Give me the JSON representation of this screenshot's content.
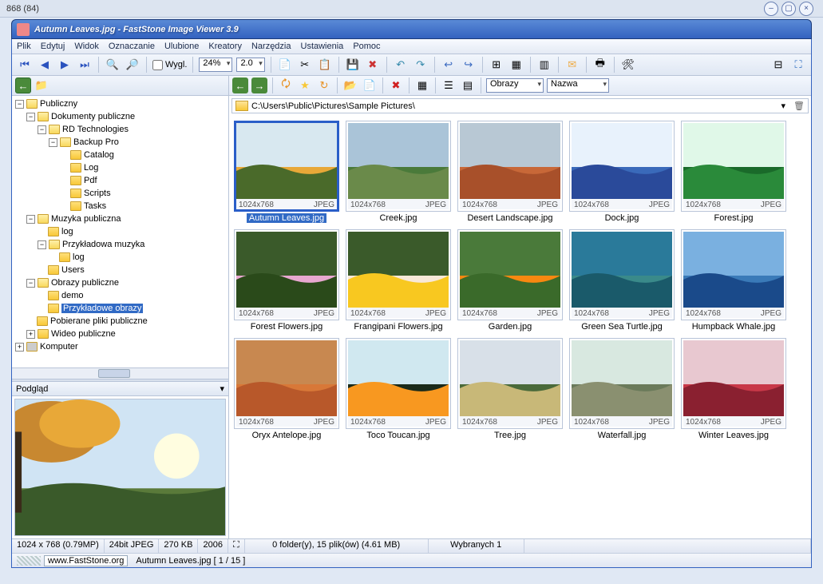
{
  "topbar_text": "868 (84)",
  "window_title": "Autumn Leaves.jpg  -  FastStone Image Viewer 3.9",
  "menu": [
    "Plik",
    "Edytuj",
    "Widok",
    "Oznaczanie",
    "Ulubione",
    "Kreatory",
    "Narzędzia",
    "Ustawienia",
    "Pomoc"
  ],
  "toolbar": {
    "wygl_label": "Wygl.",
    "zoom": "24%",
    "scale": "2.0"
  },
  "tree": {
    "root": "Publiczny",
    "n1": "Dokumenty publiczne",
    "n2": "RD Technologies",
    "n3": "Backup Pro",
    "n3_children": [
      "Catalog",
      "Log",
      "Pdf",
      "Scripts",
      "Tasks"
    ],
    "n4": "Muzyka publiczna",
    "n4a": "log",
    "n4b": "Przykładowa muzyka",
    "n4b1": "log",
    "n4c": "Users",
    "n5": "Obrazy publiczne",
    "n5a": "demo",
    "n5b": "Przykładowe obrazy",
    "n6": "Pobierane pliki publiczne",
    "n7": "Wideo publiczne",
    "n8": "Komputer"
  },
  "preview_label": "Podgląd",
  "right_toolbar": {
    "filter": "Obrazy",
    "sort": "Nazwa"
  },
  "path": "C:\\Users\\Public\\Pictures\\Sample Pictures\\",
  "thumb_dims": "1024x768",
  "thumb_fmt": "JPEG",
  "thumbnails": [
    {
      "name": "Autumn Leaves.jpg",
      "selected": true,
      "c1": "#e8a838",
      "c2": "#4a6a2a",
      "sky": "#d8e8f0"
    },
    {
      "name": "Creek.jpg",
      "c1": "#4a7a3a",
      "c2": "#6a8a4a",
      "sky": "#aac4d8"
    },
    {
      "name": "Desert Landscape.jpg",
      "c1": "#c86838",
      "c2": "#a8502a",
      "sky": "#b8c8d4"
    },
    {
      "name": "Dock.jpg",
      "c1": "#3a6aba",
      "c2": "#2a4a9a",
      "sky": "#e8f2fc"
    },
    {
      "name": "Forest.jpg",
      "c1": "#1a6a2a",
      "c2": "#2a8a3a",
      "sky": "#e0f8e8"
    },
    {
      "name": "Forest Flowers.jpg",
      "c1": "#e8a8d0",
      "c2": "#2a4a1a",
      "sky": "#3a5a2a"
    },
    {
      "name": "Frangipani Flowers.jpg",
      "c1": "#f8e8d8",
      "c2": "#f8c820",
      "sky": "#3a5a2a"
    },
    {
      "name": "Garden.jpg",
      "c1": "#f88810",
      "c2": "#3a6a2a",
      "sky": "#4a7a3a"
    },
    {
      "name": "Green Sea Turtle.jpg",
      "c1": "#3a8a8a",
      "c2": "#1a5a6a",
      "sky": "#2a7a9a"
    },
    {
      "name": "Humpback Whale.jpg",
      "c1": "#3a7ab8",
      "c2": "#1a4a8a",
      "sky": "#7ab0e0"
    },
    {
      "name": "Oryx Antelope.jpg",
      "c1": "#d87838",
      "c2": "#b8582a",
      "sky": "#c88850"
    },
    {
      "name": "Toco Toucan.jpg",
      "c1": "#1a2a1a",
      "c2": "#f89820",
      "sky": "#d0e8f0"
    },
    {
      "name": "Tree.jpg",
      "c1": "#4a6a3a",
      "c2": "#c8b878",
      "sky": "#d8e0e8"
    },
    {
      "name": "Waterfall.jpg",
      "c1": "#6a7a5a",
      "c2": "#8a9070",
      "sky": "#d8e8e0"
    },
    {
      "name": "Winter Leaves.jpg",
      "c1": "#c83848",
      "c2": "#8a2030",
      "sky": "#e8c8d0"
    }
  ],
  "status": {
    "dims": "1024 x 768 (0.79MP)",
    "depth": "24bit JPEG",
    "size": "270 KB",
    "year": "2006",
    "folders": "0 folder(y), 15 plik(ów) (4.61 MB)",
    "selected": "Wybranych 1"
  },
  "footer": {
    "url": "www.FastStone.org",
    "file": "Autumn Leaves.jpg [ 1 / 15 ]"
  }
}
